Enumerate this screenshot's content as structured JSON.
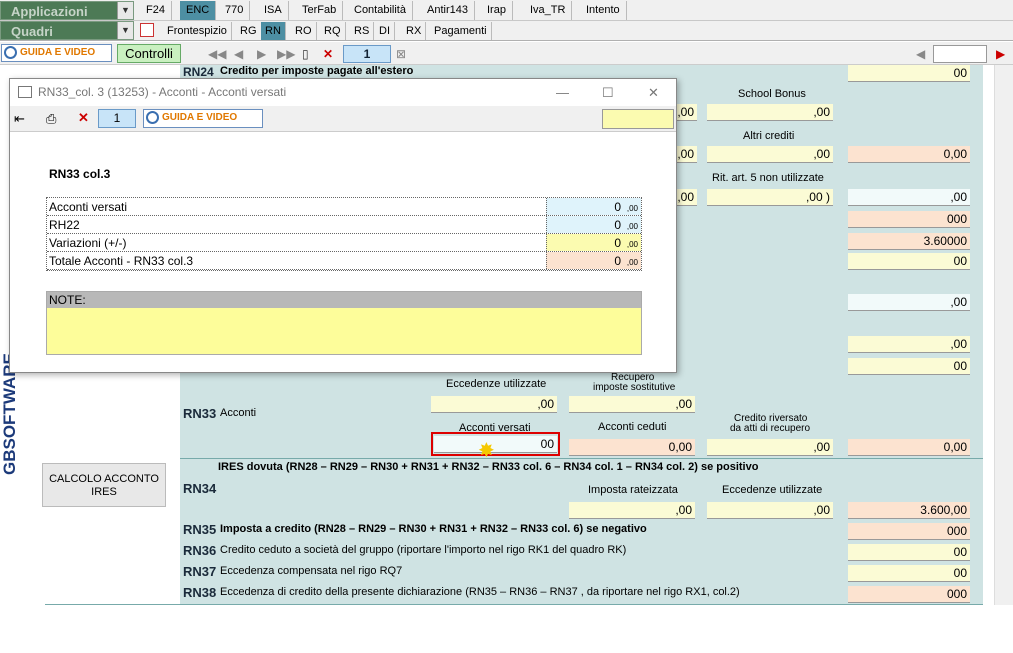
{
  "topbar": {
    "combo1": "Applicazioni",
    "combo2": "Quadri",
    "tabs": [
      "F24",
      "ENC",
      "770",
      "ISA",
      "TerFab",
      "Contabilità",
      "Antir143",
      "Irap",
      "Iva_TR",
      "Intento"
    ],
    "subtabs": [
      "Frontespizio",
      "RG",
      "RN",
      "RO",
      "RQ",
      "RS",
      "DI",
      "RX",
      "Pagamenti"
    ]
  },
  "toolbar": {
    "guida_video": "GUIDA E VIDEO",
    "controlli": "Controlli",
    "page_number": "1"
  },
  "form": {
    "rn24_code": "RN24",
    "rn24_label": "Credito per imposte pagate all'estero",
    "rn24_value": "00",
    "school_bonus": "School Bonus",
    "school_bonus_value": ",00",
    "altri_crediti": "Altri crediti",
    "altri_crediti_value": ",00",
    "altri_col7": "0,00",
    "rit_art5": "Rit. art. 5 non utilizzate",
    "rit_art5_value": ",00",
    "rit_col3": ",00",
    "val_r1": "0",
    "val_r1_dec": "00",
    "val_r2": "3.600",
    "val_r2_dec": "00",
    "val_r3": "00",
    "val_r4": ",00",
    "val_r5": ",00",
    "val_r6": "00",
    "col_00_a": ",00",
    "col_00_b": ",00",
    "col_00_c": ",00",
    "rn33_code": "RN33",
    "rn33_label": "Acconti",
    "eccedenze_utilizzate": "Eccedenze utilizzate",
    "eccedenze_value": ",00",
    "recupero_imposte": "Recupero",
    "recupero_imposte2": "imposte sostitutive",
    "recupero_value": ",00",
    "acconti_versati": "Acconti versati",
    "acconti_versati_value": "00",
    "acconti_ceduti": "Acconti ceduti",
    "acconti_ceduti_value": "0,00",
    "credito_riversato": "Credito riversato",
    "credito_riversato2": "da atti di recupero",
    "credito_riversato_value": ",00",
    "rn33_col6": "0,00",
    "ires_dovuta": "IRES dovuta (RN28 – RN29 – RN30 + RN31 + RN32 – RN33 col. 6 – RN34 col. 1 – RN34 col. 2) se positivo",
    "rn34_code": "RN34",
    "imposta_rateizzata": "Imposta rateizzata",
    "imposta_rateizzata_value": ",00",
    "eccedenze_utilizzate2": "Eccedenze utilizzate",
    "eccedenze_utilizzate2_value": ",00",
    "rn34_col3": "3.600,00",
    "rn35_code": "RN35",
    "rn35_label": "Imposta a credito (RN28 – RN29 – RN30 + RN31 + RN32 – RN33 col. 6) se negativo",
    "rn35_value": "0",
    "rn35_dec": "00",
    "rn36_code": "RN36",
    "rn36_label": "Credito ceduto a società del gruppo (riportare l'importo nel rigo RK1 del quadro RK)",
    "rn36_value": "00",
    "rn37_code": "RN37",
    "rn37_label": "Eccedenza compensata nel rigo RQ7",
    "rn37_value": "00",
    "rn38_code": "RN38",
    "rn38_label": "Eccedenza di credito della presente dichiarazione (RN35 – RN36 – RN37 , da riportare nel rigo RX1, col.2)",
    "rn38_value": "0",
    "rn38_dec": "00",
    "calcolo_btn": "CALCOLO ACCONTO IRES",
    "brand": "GBSOFTWARE"
  },
  "dialog": {
    "title": "RN33_col. 3 (13253) - Acconti - Acconti versati",
    "page": "1",
    "guida_video": "GUIDA E VIDEO",
    "heading": "RN33 col.3",
    "rows": [
      {
        "label": "Acconti versati",
        "value": "0",
        "dec": ",00"
      },
      {
        "label": "RH22",
        "value": "0",
        "dec": ",00"
      },
      {
        "label": "Variazioni (+/-)",
        "value": "0",
        "dec": ",00"
      },
      {
        "label": "Totale Acconti - RN33 col.3",
        "value": "0",
        "dec": ",00"
      }
    ],
    "note_label": "NOTE:",
    "minimize": "—",
    "maximize": "☐",
    "close": "✕"
  },
  "colors": {
    "tab_selected": "#4d8fa3",
    "form_bg": "#cfe3e3",
    "accent_orange": "#e07800"
  }
}
